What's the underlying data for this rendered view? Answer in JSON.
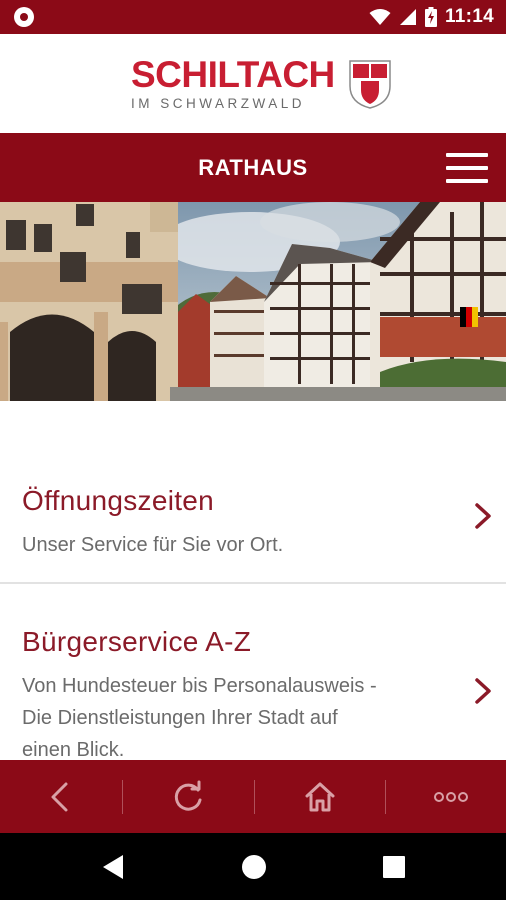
{
  "status_bar": {
    "time": "11:14"
  },
  "logo": {
    "name": "SCHILTACH",
    "subtitle": "IM SCHWARZWALD"
  },
  "header": {
    "title": "RATHAUS",
    "menu_icon": "hamburger-menu-icon"
  },
  "hero": {
    "icon": "town-photo"
  },
  "list": [
    {
      "title": "Öffnungszeiten",
      "description": "Unser Service für Sie vor Ort.",
      "icon": "chevron-right-icon"
    },
    {
      "title": "Bürgerservice A-Z",
      "description_lines": [
        "Von Hundesteuer bis Personalausweis -",
        "Die Dienstleistungen Ihrer Stadt auf",
        "einen Blick."
      ],
      "icon": "chevron-right-icon"
    }
  ],
  "bottom_nav": {
    "buttons": [
      "back-icon",
      "refresh-icon",
      "home-icon",
      "more-icon"
    ]
  },
  "system_nav": {
    "buttons": [
      "back-triangle-icon",
      "home-circle-icon",
      "recents-square-icon"
    ]
  },
  "colors": {
    "brand_dark": "#8b0a17",
    "brand_red": "#c81e32",
    "title_red": "#8b1a28",
    "text_gray": "#6b6b6b"
  }
}
